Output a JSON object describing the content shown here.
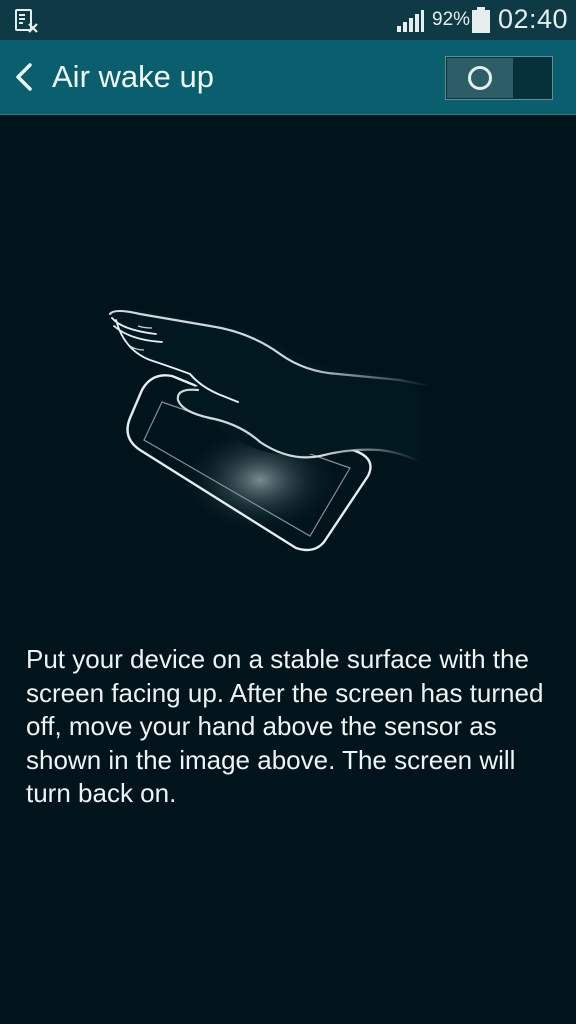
{
  "status_bar": {
    "battery_percent": "92%",
    "time": "02:40",
    "icons": [
      "notification-sim-icon",
      "signal-icon",
      "battery-icon"
    ]
  },
  "action_bar": {
    "title": "Air wake up",
    "back_icon": "chevron-left-icon",
    "toggle_on": false
  },
  "illustration": {
    "icon": "hand-over-phone-illustration"
  },
  "description": "Put your device on a stable surface with the screen facing up. After the screen has turned off, move your hand above the sensor as shown in the image above. The screen will turn back on.",
  "colors": {
    "background": "#01141b",
    "status_bar": "#0d3a45",
    "action_bar": "#095f6d",
    "text": "#eef3f4"
  }
}
